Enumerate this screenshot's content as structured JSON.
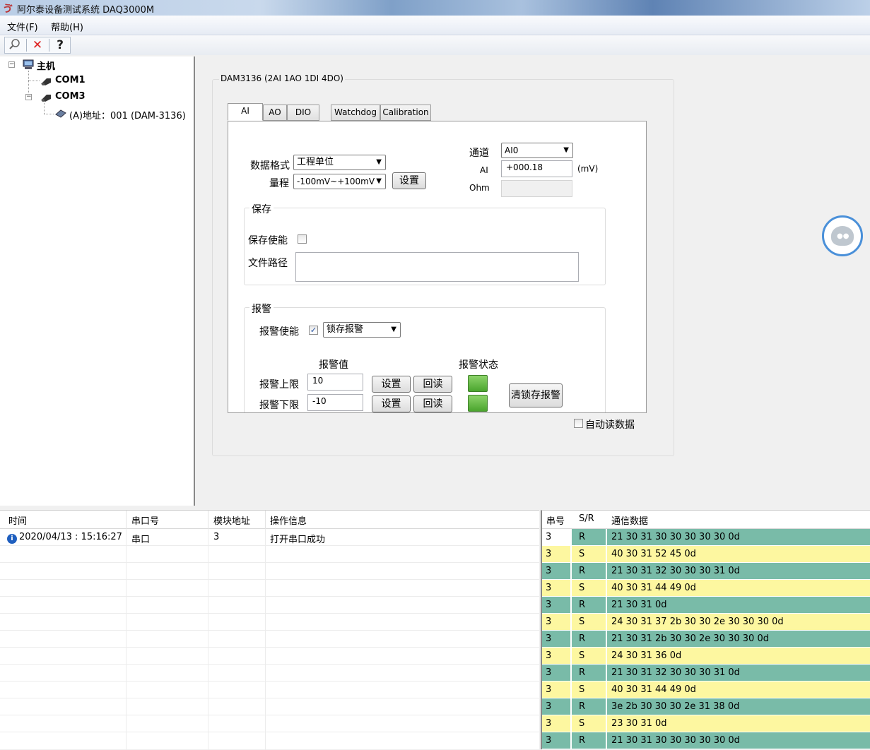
{
  "window": {
    "title": "阿尔泰设备测试系统 DAQ3000M"
  },
  "menu": {
    "file": "文件(F)",
    "help": "帮助(H)"
  },
  "toolbar": {
    "search_icon": "search-icon",
    "delete_icon": "close-icon",
    "help_icon": "help-icon"
  },
  "tree": {
    "root": "主机",
    "com1": "COM1",
    "com3": "COM3",
    "device": "(A)地址：001 (DAM-3136)"
  },
  "device_panel": {
    "title": "DAM3136 (2AI 1AO 1DI 4DO)",
    "tabs": [
      "AI",
      "AO",
      "DIO",
      "Watchdog",
      "Calibration"
    ],
    "data_format_label": "数据格式",
    "data_format_value": "工程单位",
    "range_label": "量程",
    "range_value": "-100mV~+100mV",
    "set_label": "设置",
    "channel_label": "通道",
    "channel_value": "AI0",
    "ai_label": "AI",
    "ai_value": "+000.18",
    "ai_unit": "(mV)",
    "ohm_label": "Ohm",
    "ohm_value": "",
    "save_group": "保存",
    "save_enable_label": "保存使能",
    "file_path_label": "文件路径",
    "alarm_group": "报警",
    "alarm_enable_label": "报警使能",
    "alarm_mode_value": "锁存报警",
    "alarm_value_header": "报警值",
    "alarm_status_header": "报警状态",
    "alarm_high_label": "报警上限",
    "alarm_high_value": "10",
    "alarm_low_label": "报警下限",
    "alarm_low_value": "-10",
    "readback_label": "回读",
    "clear_latch_label": "清锁存报警",
    "auto_read_label": "自动读数据"
  },
  "log": {
    "headers": [
      "时间",
      "串口号",
      "模块地址",
      "操作信息"
    ],
    "rows": [
      {
        "time": "2020/04/13 : 15:16:27",
        "port": "串口",
        "addr": "3",
        "info": "打开串口成功"
      }
    ]
  },
  "comm": {
    "headers": [
      "串号",
      "S/R",
      "通信数据"
    ],
    "colors": {
      "R": "#79bba8",
      "S": "#fdf7a0"
    },
    "rows": [
      {
        "no": "3",
        "sr": "R",
        "data": "21 30 31 30 30 30 30 30 0d"
      },
      {
        "no": "3",
        "sr": "S",
        "data": "40 30 31 52 45 0d"
      },
      {
        "no": "3",
        "sr": "R",
        "data": "21 30 31 32 30 30 30 31 0d"
      },
      {
        "no": "3",
        "sr": "S",
        "data": "40 30 31 44 49 0d"
      },
      {
        "no": "3",
        "sr": "R",
        "data": "21 30 31 0d"
      },
      {
        "no": "3",
        "sr": "S",
        "data": "24 30 31 37 2b 30 30 2e 30 30 30 0d"
      },
      {
        "no": "3",
        "sr": "R",
        "data": "21 30 31 2b 30 30 2e 30 30 30 0d"
      },
      {
        "no": "3",
        "sr": "S",
        "data": "24 30 31 36 0d"
      },
      {
        "no": "3",
        "sr": "R",
        "data": "21 30 31 32 30 30 30 31 0d"
      },
      {
        "no": "3",
        "sr": "S",
        "data": "40 30 31 44 49 0d"
      },
      {
        "no": "3",
        "sr": "R",
        "data": "3e 2b 30 30 30 2e 31 38 0d"
      },
      {
        "no": "3",
        "sr": "S",
        "data": "23 30 31 0d"
      },
      {
        "no": "3",
        "sr": "R",
        "data": "21 30 31 30 30 30 30 30 0d"
      }
    ]
  }
}
